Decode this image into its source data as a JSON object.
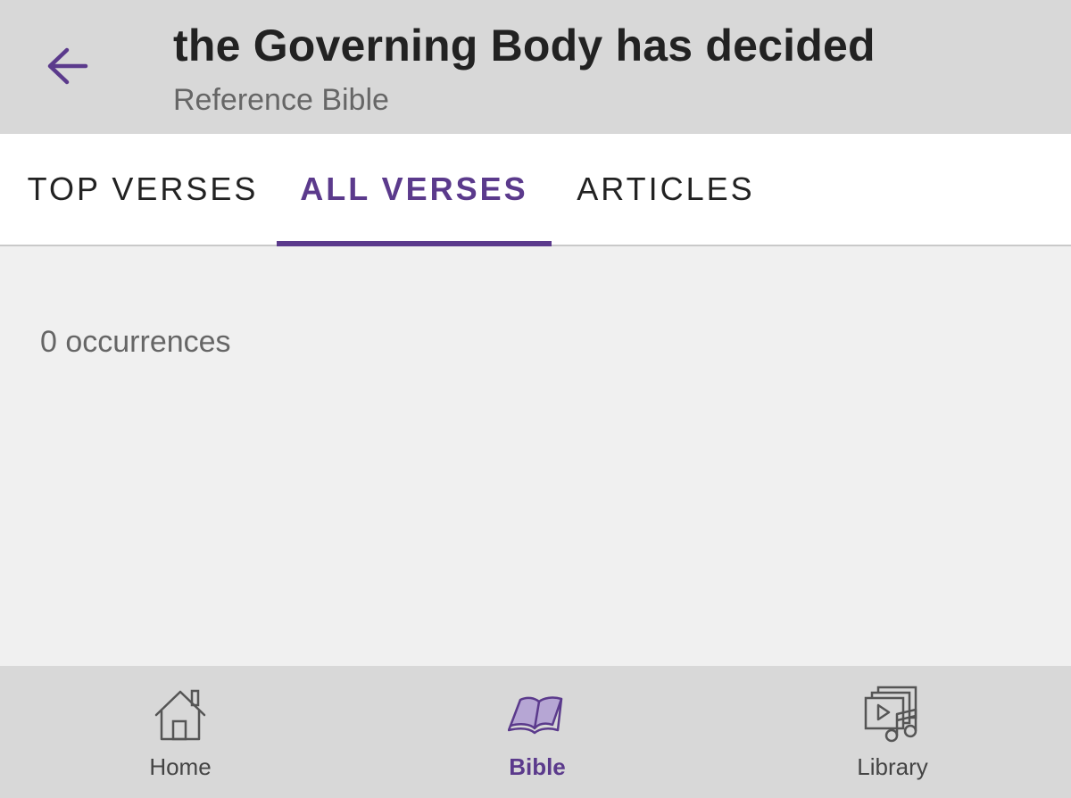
{
  "header": {
    "title": "the Governing Body has decided",
    "subtitle": "Reference Bible",
    "back_icon": "arrow-left-icon"
  },
  "tabs": [
    {
      "label": "TOP VERSES",
      "active": false
    },
    {
      "label": "ALL VERSES",
      "active": true
    },
    {
      "label": "ARTICLES",
      "active": false
    }
  ],
  "content": {
    "occurrences_text": "0 occurrences"
  },
  "bottom_nav": [
    {
      "label": "Home",
      "icon": "home-icon",
      "active": false
    },
    {
      "label": "Bible",
      "icon": "bible-icon",
      "active": true
    },
    {
      "label": "Library",
      "icon": "library-icon",
      "active": false
    }
  ],
  "colors": {
    "accent": "#5b3a8c",
    "header_bg": "#d8d8d8",
    "content_bg": "#f0f0f0"
  }
}
